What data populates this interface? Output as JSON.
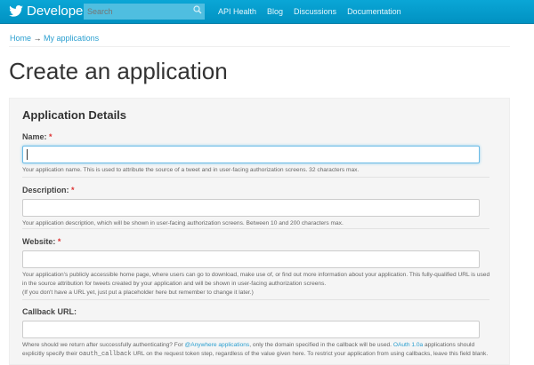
{
  "header": {
    "brand": "Developers",
    "search_placeholder": "Search",
    "nav": [
      "API Health",
      "Blog",
      "Discussions",
      "Documentation"
    ]
  },
  "breadcrumb": {
    "home": "Home",
    "arrow": "→",
    "current": "My applications"
  },
  "page_title": "Create an application",
  "panel_title": "Application Details",
  "fields": [
    {
      "label": "Name:",
      "required": "*",
      "value": "",
      "help": "Your application name. This is used to attribute the source of a tweet and in user-facing authorization screens. 32 characters max."
    },
    {
      "label": "Description:",
      "required": "*",
      "value": "",
      "help": "Your application description, which will be shown in user-facing authorization screens. Between 10 and 200 characters max."
    },
    {
      "label": "Website:",
      "required": "*",
      "value": "",
      "help": "Your application's publicly accessible home page, where users can go to download, make use of, or find out more information about your application. This fully-qualified URL is used in the source attribution for tweets created by your application and will be shown in user-facing authorization screens.",
      "help2": "(If you don't have a URL yet, just put a placeholder here but remember to change it later.)"
    },
    {
      "label": "Callback URL:",
      "value": "",
      "help_a": "Where should we return after successfully authenticating? For ",
      "link1": "@Anywhere applications",
      "help_b": ", only the domain specified in the callback will be used. ",
      "link2": "OAuth 1.0a",
      "help_c": " applications should explicitly specify their ",
      "code": "oauth_callback",
      "help_d": " URL on the request token step, regardless of the value given here. To restrict your application from using callbacks, leave this field blank."
    }
  ]
}
